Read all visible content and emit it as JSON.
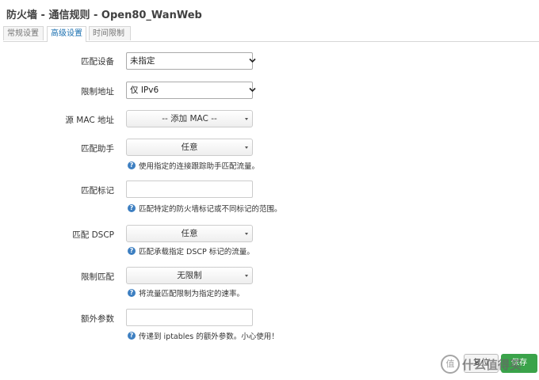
{
  "page_title": "防火墙 - 通信规则 - Open80_WanWeb",
  "tabs": [
    {
      "label": "常规设置"
    },
    {
      "label": "高级设置"
    },
    {
      "label": "时间限制"
    }
  ],
  "fields": {
    "match_device": {
      "label": "匹配设备",
      "value": "未指定"
    },
    "restrict_address": {
      "label": "限制地址",
      "value": "仅 IPv6"
    },
    "source_mac": {
      "label": "源 MAC 地址",
      "value": "-- 添加 MAC --"
    },
    "match_helper": {
      "label": "匹配助手",
      "value": "任意",
      "hint": "使用指定的连接跟踪助手匹配流量。"
    },
    "match_mark": {
      "label": "匹配标记",
      "value": "",
      "hint": "匹配特定的防火墙标记或不同标记的范围。"
    },
    "match_dscp": {
      "label": "匹配 DSCP",
      "value": "任意",
      "hint": "匹配承载指定 DSCP 标记的流量。"
    },
    "limit_match": {
      "label": "限制匹配",
      "value": "无限制",
      "hint": "将流量匹配限制为指定的速率。"
    },
    "extra_args": {
      "label": "额外参数",
      "value": "",
      "hint": "传递到 iptables 的额外参数。小心使用！"
    }
  },
  "buttons": {
    "reset_label": "复位",
    "save_label": "保存"
  },
  "watermark": {
    "circle_text": "值",
    "text": "什么值得买"
  },
  "colors": {
    "accent": "#1a6fb0",
    "help_icon": "#3d7fc1",
    "save_button": "#3aa34a"
  },
  "icons": {
    "help": "question-circle-icon",
    "select_arrow": "chevron-down-icon",
    "dropdown_caret": "caret-down-icon"
  }
}
